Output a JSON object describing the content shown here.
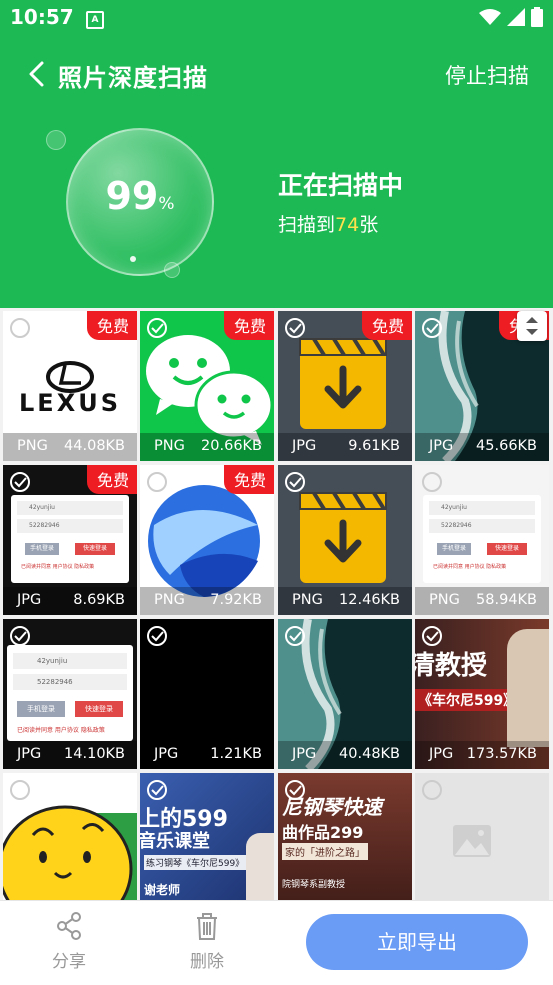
{
  "status_bar": {
    "time": "10:57",
    "app_badge": "A"
  },
  "header": {
    "title": "照片深度扫描",
    "stop_label": "停止扫描"
  },
  "progress": {
    "percent_value": "99",
    "percent_symbol": "%",
    "status_text": "正在扫描中",
    "count_prefix": "扫描到",
    "count": "74",
    "count_suffix": "张"
  },
  "grid": {
    "free_label": "免费",
    "items": [
      {
        "format": "PNG",
        "size": "44.08KB",
        "free": true,
        "thumb": "lexus-logo"
      },
      {
        "format": "PNG",
        "size": "20.66KB",
        "free": true,
        "thumb": "wechat-logo"
      },
      {
        "format": "JPG",
        "size": "9.61KB",
        "free": true,
        "thumb": "video-download-icon"
      },
      {
        "format": "JPG",
        "size": "45.66KB",
        "free": true,
        "thumb": "ocean-waves-photo"
      },
      {
        "format": "JPG",
        "size": "8.69KB",
        "free": true,
        "thumb": "login-form-screenshot"
      },
      {
        "format": "PNG",
        "size": "7.92KB",
        "free": true,
        "thumb": "blue-swirl-logo"
      },
      {
        "format": "PNG",
        "size": "12.46KB",
        "free": false,
        "thumb": "video-download-icon"
      },
      {
        "format": "PNG",
        "size": "58.94KB",
        "free": false,
        "thumb": "login-form-screenshot"
      },
      {
        "format": "JPG",
        "size": "14.10KB",
        "free": false,
        "thumb": "login-form-screenshot"
      },
      {
        "format": "JPG",
        "size": "1.21KB",
        "free": false,
        "thumb": "black-image"
      },
      {
        "format": "JPG",
        "size": "40.48KB",
        "free": false,
        "thumb": "ocean-waves-photo"
      },
      {
        "format": "JPG",
        "size": "173.57KB",
        "free": false,
        "thumb": "piano-course-banner"
      },
      {
        "format": "",
        "size": "",
        "free": false,
        "thumb": "yellow-emoji"
      },
      {
        "format": "",
        "size": "",
        "free": false,
        "thumb": "music-course-banner"
      },
      {
        "format": "",
        "size": "",
        "free": false,
        "thumb": "piano-works-banner"
      },
      {
        "format": "",
        "size": "",
        "free": false,
        "thumb": "image-placeholder"
      }
    ],
    "thumb_text": {
      "lexus": "LEXUS",
      "form_account": "42yunjiu",
      "form_password": "52282946",
      "form_btn_phone": "手机登录",
      "form_btn_quick": "快速登录",
      "form_agree": "已阅读并同意 用户协议 隐私政策",
      "piano1_line1": "清教授",
      "piano1_line2": "《车尔尼599》",
      "music_line1": "上的599",
      "music_line2": "音乐课堂",
      "music_line3": "练习钢琴《车尔尼599》",
      "music_line4": "谢老师",
      "piano2_line1": "尼钢琴快速",
      "piano2_line2": "曲作品299",
      "piano2_line3": "家的「进阶之路」",
      "piano2_line4": "院钢琴系副教授"
    }
  },
  "bottom_bar": {
    "share_label": "分享",
    "delete_label": "删除",
    "export_label": "立即导出"
  },
  "colors": {
    "primary_green": "#1db954",
    "free_badge": "#ee1d23",
    "highlight_yellow": "#ffe14d",
    "export_button": "#6a9bf5"
  }
}
